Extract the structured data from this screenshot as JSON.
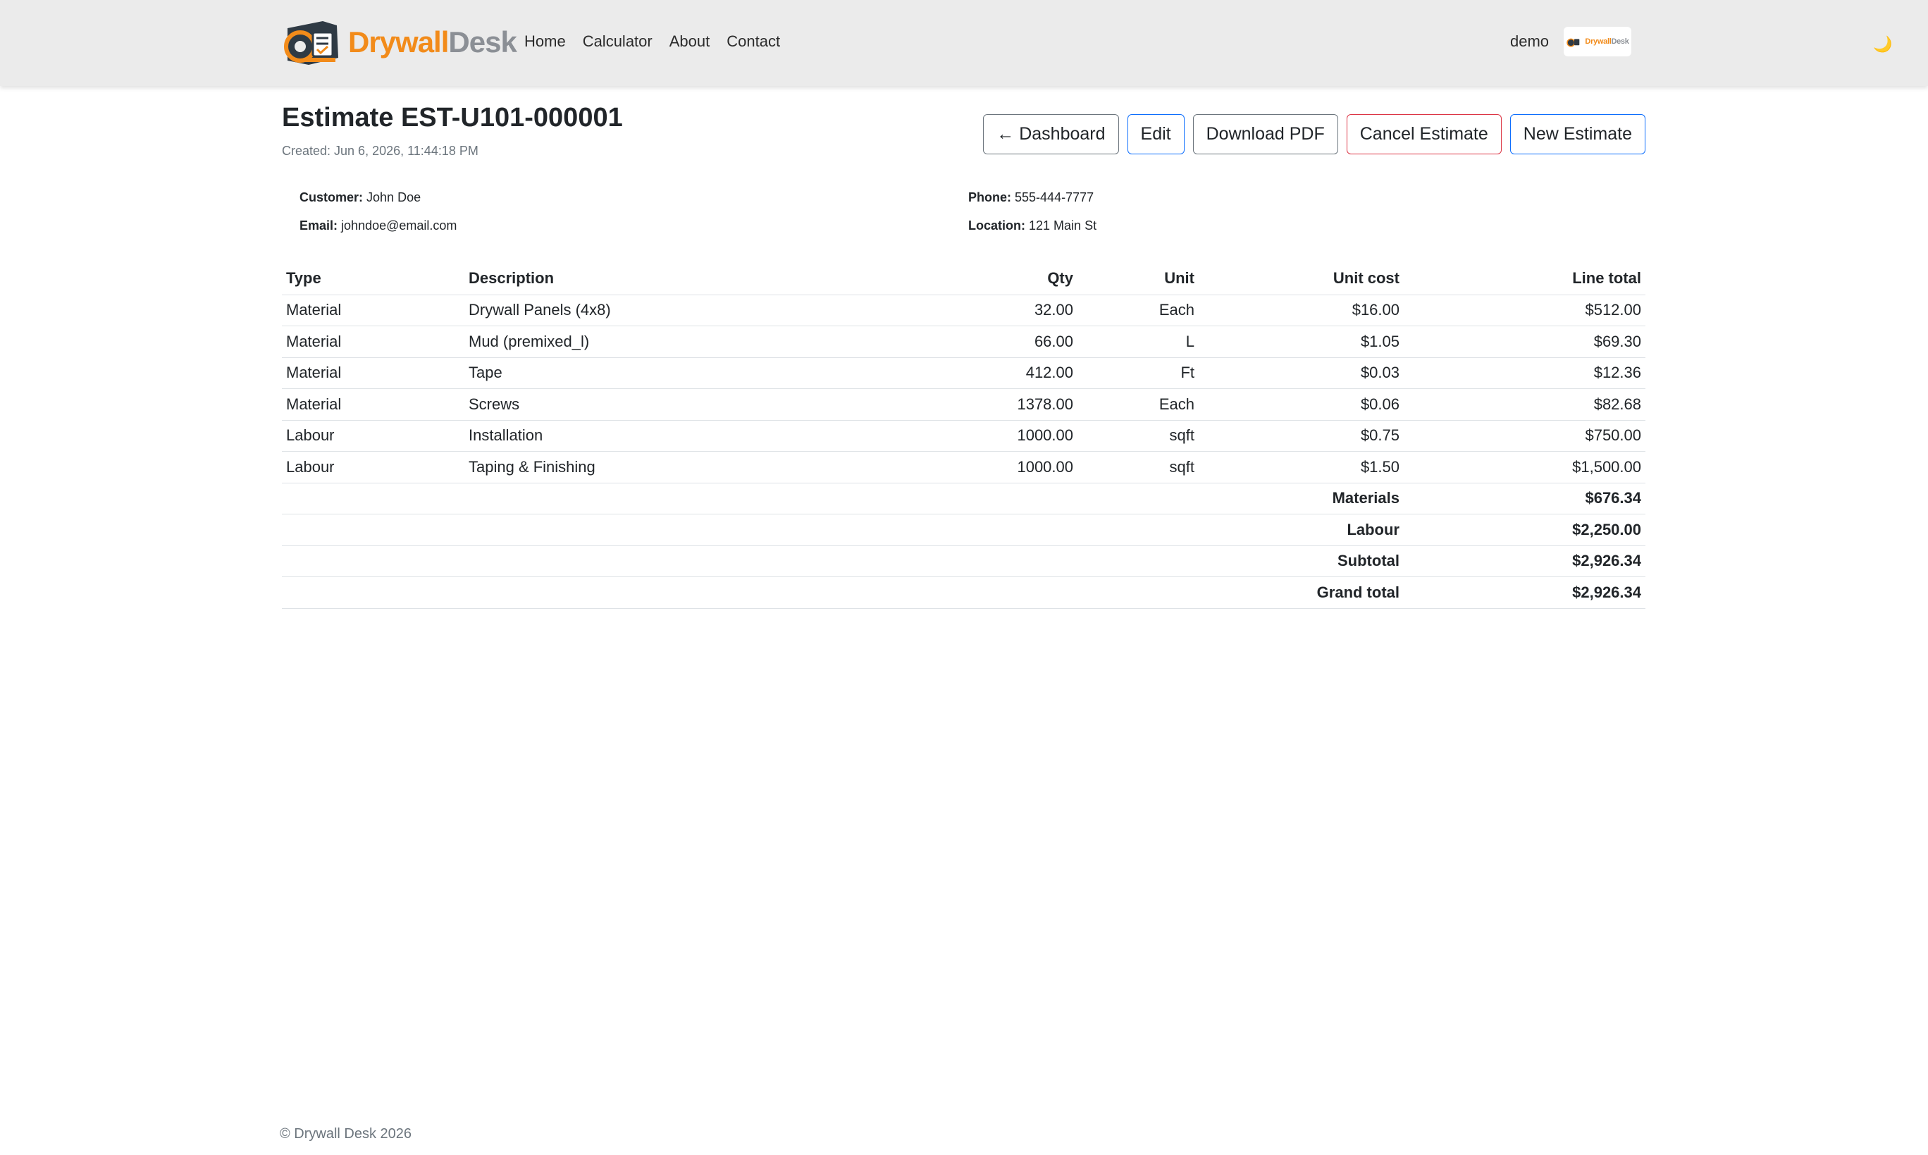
{
  "nav": {
    "brand_a": "Drywall",
    "brand_b": "Desk",
    "links": [
      "Home",
      "Calculator",
      "About",
      "Contact"
    ],
    "user": "demo",
    "theme_icon": "moon-icon"
  },
  "estimate": {
    "title": "Estimate EST-U101-000001",
    "created": "Created: Jun 6, 2026, 11:44:18 PM"
  },
  "actions": {
    "dashboard": "← Dashboard",
    "edit": "Edit",
    "download": "Download PDF",
    "cancel": "Cancel Estimate",
    "new": "New Estimate"
  },
  "customer": {
    "customer_label": "Customer:",
    "customer": "John Doe",
    "phone_label": "Phone:",
    "phone": "555-444-7777",
    "email_label": "Email:",
    "email": "johndoe@email.com",
    "location_label": "Location:",
    "location": "121 Main St"
  },
  "table": {
    "headers": [
      "Type",
      "Description",
      "Qty",
      "Unit",
      "Unit cost",
      "Line total"
    ],
    "rows": [
      [
        "Material",
        "Drywall Panels (4x8)",
        "32.00",
        "Each",
        "$16.00",
        "$512.00"
      ],
      [
        "Material",
        "Mud (premixed_l)",
        "66.00",
        "L",
        "$1.05",
        "$69.30"
      ],
      [
        "Material",
        "Tape",
        "412.00",
        "Ft",
        "$0.03",
        "$12.36"
      ],
      [
        "Material",
        "Screws",
        "1378.00",
        "Each",
        "$0.06",
        "$82.68"
      ],
      [
        "Labour",
        "Installation",
        "1000.00",
        "sqft",
        "$0.75",
        "$750.00"
      ],
      [
        "Labour",
        "Taping & Finishing",
        "1000.00",
        "sqft",
        "$1.50",
        "$1,500.00"
      ]
    ],
    "totals": [
      [
        "Materials",
        "$676.34"
      ],
      [
        "Labour",
        "$2,250.00"
      ],
      [
        "Subtotal",
        "$2,926.34"
      ],
      [
        "Grand total",
        "$2,926.34"
      ]
    ]
  },
  "footer": "© Drywall Desk 2026"
}
